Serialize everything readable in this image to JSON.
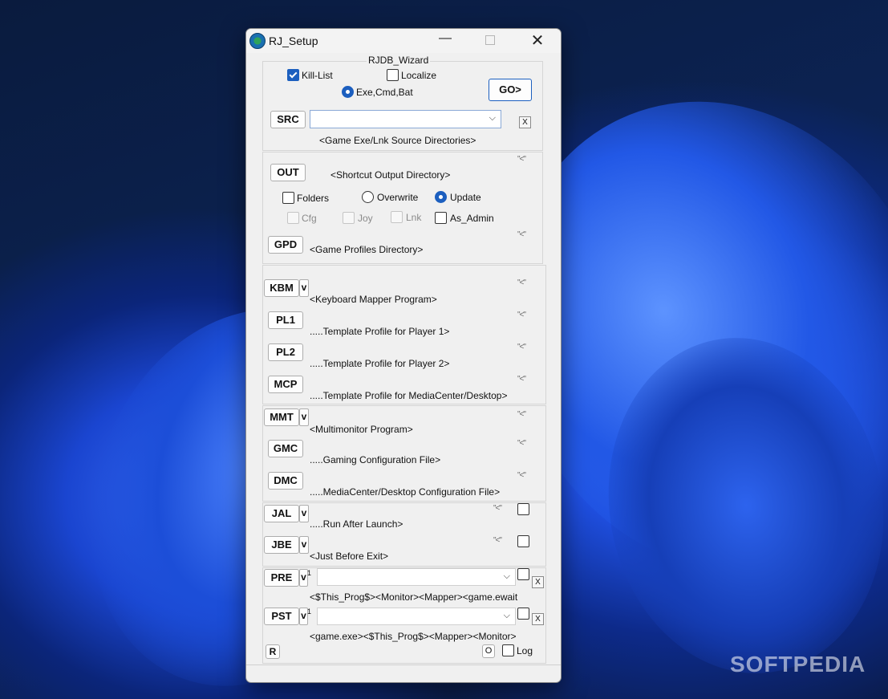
{
  "watermark": "SOFTPEDIA",
  "window": {
    "title": "RJ_Setup",
    "minimize_glyph": "—",
    "close_glyph": "✕"
  },
  "wizard": {
    "legend": "RJDB_Wizard",
    "kill_list": {
      "label": "Kill-List",
      "checked": true
    },
    "localize": {
      "label": "Localize",
      "checked": false
    },
    "exe_cmd_bat": {
      "label": "Exe,Cmd,Bat",
      "selected": true
    },
    "go_label": "GO>",
    "src_label": "SRC",
    "src_clear": "X",
    "src_caption": "<Game Exe/Lnk Source Directories>"
  },
  "output": {
    "out_label": "OUT",
    "out_caption": "<Shortcut Output Directory>",
    "quote": "\"<\"",
    "folders": "Folders",
    "overwrite": "Overwrite",
    "update": "Update",
    "cfg": "Cfg",
    "joy": "Joy",
    "lnk": "Lnk",
    "as_admin": "As_Admin",
    "gpd_label": "GPD",
    "gpd_caption": "<Game Profiles Directory>"
  },
  "mapper": {
    "kbm_label": "KBM",
    "v": "v",
    "kbm_caption": "<Keyboard Mapper Program>",
    "pl1_label": "PL1",
    "pl1_caption": ".....Template Profile for Player 1>",
    "pl2_label": "PL2",
    "pl2_caption": ".....Template Profile for Player 2>",
    "mcp_label": "MCP",
    "mcp_caption": ".....Template Profile for MediaCenter/Desktop>"
  },
  "monitor": {
    "mmt_label": "MMT",
    "mmt_caption": "<Multimonitor Program>",
    "gmc_label": "GMC",
    "gmc_caption": ".....Gaming Configuration File>",
    "dmc_label": "DMC",
    "dmc_caption": ".....MediaCenter/Desktop Configuration File>"
  },
  "launch": {
    "jal_label": "JAL",
    "jal_caption": ".....Run After Launch>",
    "jbe_label": "JBE",
    "jbe_caption": "<Just Before Exit>"
  },
  "prepost": {
    "pre_label": "PRE",
    "one": "1",
    "pre_caption": "<$This_Prog$><Monitor><Mapper><game.ewait",
    "pst_label": "PST",
    "pst_caption": "<game.exe><$This_Prog$><Mapper><Monitor>",
    "x": "X",
    "r_label": "R",
    "o_label": "O",
    "log_label": "Log"
  }
}
